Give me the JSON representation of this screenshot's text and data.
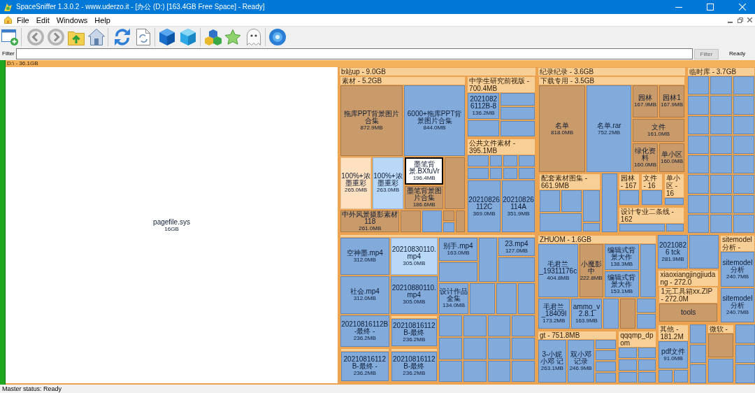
{
  "window": {
    "title": "SpaceSniffer 1.3.0.2 - www.uderzo.it - [办公 (D:) [163.4GB Free Space] - Ready]"
  },
  "menu": [
    "File",
    "Edit",
    "Windows",
    "Help"
  ],
  "filter": {
    "label": "Filter",
    "button": {
      "label": "Filter",
      "disabled": true
    },
    "status": "Ready"
  },
  "root": {
    "label": "D:\\ - 36.1GB",
    "children": [
      {
        "kind": "plain",
        "name": "pagefile.sys",
        "size": "16GB",
        "selected": false,
        "highlighted": false
      },
      {
        "kind": "folder",
        "label": "b站up - 9.0GB",
        "selected": false,
        "highlighted": false,
        "children": [
          {
            "kind": "folder",
            "label": "素材 - 5.2GB",
            "selected": false,
            "highlighted": false,
            "children": [
              {
                "kind": "dir",
                "name": "拖库PPT背景图片合集",
                "size": "872.9MB",
                "selected": false,
                "highlighted": false
              },
              {
                "kind": "file",
                "name": "6000+拖库PPT背景图片合集",
                "size": "844.0MB",
                "selected": false,
                "highlighted": false
              },
              {
                "kind": "dir",
                "name": "100%+浓墨重彩",
                "size": "265.0MB",
                "selected": false,
                "highlighted": true
              },
              {
                "kind": "file",
                "name": "100%+浓墨重彩",
                "size": "263.0MB",
                "selected": false,
                "highlighted": true
              },
              {
                "kind": "file",
                "name": "墨笔背景.BXfuVr",
                "size": "196.4MB",
                "selected": true,
                "highlighted": false
              },
              {
                "kind": "dir",
                "name": "墨笔背景图片合集",
                "size": "186.6MB",
                "selected": false,
                "highlighted": false
              },
              {
                "kind": "dir",
                "selected": false,
                "highlighted": false
              },
              {
                "kind": "dir",
                "name": "中外风景摄影素材 118",
                "size": "261.0MB",
                "selected": false,
                "highlighted": false
              },
              {
                "kind": "dir",
                "selected": false,
                "highlighted": false
              },
              {
                "kind": "file",
                "selected": false,
                "highlighted": false
              },
              {
                "kind": "dir",
                "selected": false,
                "highlighted": false
              },
              {
                "kind": "file",
                "selected": false,
                "highlighted": false
              },
              {
                "kind": "dir",
                "selected": false,
                "highlighted": false
              }
            ]
          },
          {
            "kind": "folder",
            "label": "中学生研究前视版 - 700.4MB",
            "selected": false,
            "highlighted": false,
            "children": [
              {
                "kind": "file",
                "name": "20210826112B-8",
                "size": "136.2MB",
                "selected": false,
                "highlighted": false
              },
              {
                "kind": "file",
                "selected": false,
                "highlighted": false
              },
              {
                "kind": "file",
                "selected": false,
                "highlighted": false
              },
              {
                "kind": "file",
                "selected": false,
                "highlighted": false
              },
              {
                "kind": "file",
                "selected": false,
                "highlighted": false
              }
            ]
          },
          {
            "kind": "folder",
            "label": "公共文件素材 - 395.1MB",
            "selected": false,
            "highlighted": false,
            "children": [
              {
                "kind": "file",
                "selected": false,
                "highlighted": false
              },
              {
                "kind": "file",
                "selected": false,
                "highlighted": false
              },
              {
                "kind": "file",
                "selected": false,
                "highlighted": false
              },
              {
                "kind": "file",
                "selected": false,
                "highlighted": false
              },
              {
                "kind": "file",
                "selected": false,
                "highlighted": false
              },
              {
                "kind": "file",
                "selected": false,
                "highlighted": false
              },
              {
                "kind": "file",
                "selected": false,
                "highlighted": false
              },
              {
                "kind": "file",
                "selected": false,
                "highlighted": false
              },
              {
                "kind": "file",
                "name": "20210826112C",
                "size": "369.0MB",
                "selected": false,
                "highlighted": false
              },
              {
                "kind": "file",
                "name": "20210826114A",
                "size": "351.9MB",
                "selected": false,
                "highlighted": false
              }
            ]
          },
          {
            "kind": "folder",
            "selected": false,
            "highlighted": false,
            "children": [
              {
                "kind": "file",
                "name": "空神墨.mp4",
                "size": "312.0MB",
                "selected": false,
                "highlighted": false
              },
              {
                "kind": "file",
                "name": "社会.mp4",
                "size": "312.0MB",
                "selected": false,
                "highlighted": false
              },
              {
                "kind": "file",
                "name": "20210830110.mp4",
                "size": "305.0MB",
                "selected": false,
                "highlighted": true
              },
              {
                "kind": "file",
                "name": "20210880110.mp4",
                "size": "305.0MB",
                "selected": false,
                "highlighted": false
              },
              {
                "kind": "file",
                "name": "别手.mp4",
                "size": "163.0MB",
                "selected": false,
                "highlighted": false
              },
              {
                "kind": "file",
                "selected": false,
                "highlighted": false
              },
              {
                "kind": "file",
                "selected": false,
                "highlighted": false
              },
              {
                "kind": "file",
                "name": "23.mp4",
                "size": "127.0MB",
                "selected": false,
                "highlighted": false
              },
              {
                "kind": "file",
                "selected": false,
                "highlighted": false
              },
              {
                "kind": "file",
                "name": "设计作品全集",
                "size": "134.0MB",
                "selected": false,
                "highlighted": false
              },
              {
                "kind": "file",
                "selected": false,
                "highlighted": false
              },
              {
                "kind": "file",
                "selected": false,
                "highlighted": false
              },
              {
                "kind": "file",
                "selected": false,
                "highlighted": false
              },
              {
                "kind": "file",
                "name": "20210816112B-最终 -",
                "size": "236.2MB",
                "selected": false,
                "highlighted": false
              },
              {
                "kind": "folder",
                "selected": false,
                "highlighted": false,
                "children": [
                  {
                    "kind": "file",
                    "name": "20210816112B-最终 -",
                    "size": "236.2MB",
                    "selected": false,
                    "highlighted": false
                  }
                ]
              },
              {
                "kind": "folder",
                "selected": false,
                "highlighted": false,
                "children": [
                  {
                    "kind": "file",
                    "name": "20210816112B-最终",
                    "size": "236.2MB",
                    "selected": false,
                    "highlighted": false
                  }
                ]
              },
              {
                "kind": "folder",
                "selected": false,
                "highlighted": false,
                "children": [
                  {
                    "kind": "file",
                    "name": "20210816112B-最终",
                    "size": "236.2MB",
                    "selected": false,
                    "highlighted": false
                  }
                ]
              },
              {
                "kind": "file",
                "selected": false,
                "highlighted": false
              },
              {
                "kind": "file",
                "selected": false,
                "highlighted": false
              },
              {
                "kind": "file",
                "selected": false,
                "highlighted": false
              },
              {
                "kind": "file",
                "selected": false,
                "highlighted": false
              },
              {
                "kind": "file",
                "selected": false,
                "highlighted": false
              },
              {
                "kind": "file",
                "selected": false,
                "highlighted": false
              },
              {
                "kind": "file",
                "selected": false,
                "highlighted": false
              },
              {
                "kind": "file",
                "selected": false,
                "highlighted": false
              },
              {
                "kind": "file",
                "selected": false,
                "highlighted": false
              },
              {
                "kind": "file",
                "selected": false,
                "highlighted": false
              },
              {
                "kind": "file",
                "selected": false,
                "highlighted": false
              },
              {
                "kind": "file",
                "selected": false,
                "highlighted": false
              }
            ]
          }
        ]
      },
      {
        "kind": "folder",
        "label": "纪录纪录 - 3.6GB",
        "selected": false,
        "highlighted": false,
        "children": [
          {
            "kind": "folder",
            "label": "下载专用 - 3.5GB",
            "selected": false,
            "highlighted": false,
            "children": [
              {
                "kind": "dir",
                "name": "名单",
                "size": "818.0MB",
                "selected": false,
                "highlighted": false
              },
              {
                "kind": "file",
                "name": "名单.rar",
                "size": "752.2MB",
                "selected": false,
                "highlighted": false
              },
              {
                "kind": "dir",
                "name": "园林",
                "size": "167.9MB",
                "selected": false,
                "highlighted": false
              },
              {
                "kind": "dir",
                "name": "园林1",
                "size": "167.9MB",
                "selected": false,
                "highlighted": false
              },
              {
                "kind": "dir",
                "name": "文件",
                "size": "161.0MB",
                "selected": false,
                "highlighted": false
              },
              {
                "kind": "dir",
                "name": "绿化资料",
                "size": "160.0MB",
                "selected": false,
                "highlighted": false
              },
              {
                "kind": "dir",
                "name": "单小区",
                "size": "160.0MB",
                "selected": false,
                "highlighted": false
              },
              {
                "kind": "folder",
                "label": "配套素材图集 - 661.9MB",
                "selected": false,
                "highlighted": false,
                "children": [
                  {
                    "kind": "file",
                    "selected": false,
                    "highlighted": false
                  },
                  {
                    "kind": "file",
                    "selected": false,
                    "highlighted": false
                  },
                  {
                    "kind": "file",
                    "selected": false,
                    "highlighted": false
                  },
                  {
                    "kind": "file",
                    "selected": false,
                    "highlighted": false
                  },
                  {
                    "kind": "file",
                    "selected": false,
                    "highlighted": false
                  }
                ]
              },
              {
                "kind": "file",
                "selected": false,
                "highlighted": false
              },
              {
                "kind": "folder",
                "label": "园林 - 167",
                "selected": false,
                "highlighted": false,
                "children": [
                  {
                    "kind": "file",
                    "selected": false,
                    "highlighted": false
                  }
                ]
              },
              {
                "kind": "folder",
                "label": "文件 - 16",
                "selected": false,
                "highlighted": false,
                "children": [
                  {
                    "kind": "file",
                    "selected": false,
                    "highlighted": false
                  }
                ]
              },
              {
                "kind": "folder",
                "label": "单小区 - 16",
                "selected": false,
                "highlighted": false,
                "children": [
                  {
                    "kind": "file",
                    "selected": false,
                    "highlighted": false
                  }
                ]
              },
              {
                "kind": "folder",
                "label": "设计专业二条线 - 162",
                "selected": false,
                "highlighted": false,
                "children": [
                  {
                    "kind": "file",
                    "selected": false,
                    "highlighted": false
                  },
                  {
                    "kind": "file",
                    "selected": false,
                    "highlighted": false
                  }
                ]
              }
            ]
          }
        ]
      },
      {
        "kind": "folder",
        "label": "临时库 - 3.7GB",
        "selected": false,
        "highlighted": false,
        "children": [
          {
            "kind": "file",
            "selected": false,
            "highlighted": false
          },
          {
            "kind": "file",
            "selected": false,
            "highlighted": false
          },
          {
            "kind": "file",
            "selected": false,
            "highlighted": false
          },
          {
            "kind": "file",
            "selected": false,
            "highlighted": false
          },
          {
            "kind": "file",
            "selected": false,
            "highlighted": false
          },
          {
            "kind": "file",
            "selected": false,
            "highlighted": false
          },
          {
            "kind": "file",
            "selected": false,
            "highlighted": false
          },
          {
            "kind": "file",
            "selected": false,
            "highlighted": false
          },
          {
            "kind": "file",
            "selected": false,
            "highlighted": false
          },
          {
            "kind": "file",
            "selected": false,
            "highlighted": false
          },
          {
            "kind": "file",
            "selected": false,
            "highlighted": false
          },
          {
            "kind": "file",
            "selected": false,
            "highlighted": false
          },
          {
            "kind": "file",
            "selected": false,
            "highlighted": false
          },
          {
            "kind": "file",
            "selected": false,
            "highlighted": false
          },
          {
            "kind": "file",
            "selected": false,
            "highlighted": false
          },
          {
            "kind": "file",
            "selected": false,
            "highlighted": false
          },
          {
            "kind": "file",
            "selected": false,
            "highlighted": false
          },
          {
            "kind": "file",
            "selected": false,
            "highlighted": false
          },
          {
            "kind": "file",
            "selected": false,
            "highlighted": false
          },
          {
            "kind": "file",
            "selected": false,
            "highlighted": false
          },
          {
            "kind": "file",
            "selected": false,
            "highlighted": false
          },
          {
            "kind": "file",
            "selected": false,
            "highlighted": false
          },
          {
            "kind": "file",
            "selected": false,
            "highlighted": false
          },
          {
            "kind": "file",
            "selected": false,
            "highlighted": false
          }
        ]
      },
      {
        "kind": "folder",
        "label": "ZHUOM - 1.6GB",
        "selected": false,
        "highlighted": false,
        "children": [
          {
            "kind": "file",
            "name": "毛君兰_19311176c",
            "size": "404.8MB",
            "selected": false,
            "highlighted": false
          },
          {
            "kind": "dir",
            "name": "小魔影中",
            "size": "222.8MB",
            "selected": false,
            "highlighted": false
          },
          {
            "kind": "file",
            "name": "编辑式背景大作",
            "size": "138.3MB",
            "selected": false,
            "highlighted": false
          },
          {
            "kind": "file",
            "name": "编辑式背景大作",
            "size": "153.1MB",
            "selected": false,
            "highlighted": false
          },
          {
            "kind": "file",
            "selected": false,
            "highlighted": false
          },
          {
            "kind": "file",
            "name": "毛君兰_18409l",
            "size": "173.2MB",
            "selected": false,
            "highlighted": false
          },
          {
            "kind": "file",
            "name": "ammo_v2.8.1",
            "size": "163.9MB",
            "selected": false,
            "highlighted": false
          },
          {
            "kind": "file",
            "selected": false,
            "highlighted": false
          },
          {
            "kind": "dir",
            "selected": false,
            "highlighted": false
          },
          {
            "kind": "file",
            "selected": false,
            "highlighted": false
          },
          {
            "kind": "file",
            "selected": false,
            "highlighted": false
          }
        ]
      },
      {
        "kind": "folder",
        "label": "gt - 751.8MB",
        "selected": false,
        "highlighted": false,
        "children": [
          {
            "kind": "file",
            "name": "3-小妮小邓 记",
            "size": "263.1MB",
            "selected": false,
            "highlighted": false
          },
          {
            "kind": "file",
            "name": "双小邓记录",
            "size": "246.9MB",
            "selected": false,
            "highlighted": false
          },
          {
            "kind": "file",
            "selected": false,
            "highlighted": false
          },
          {
            "kind": "file",
            "selected": false,
            "highlighted": false
          },
          {
            "kind": "file",
            "selected": false,
            "highlighted": false
          },
          {
            "kind": "file",
            "selected": false,
            "highlighted": false
          }
        ]
      },
      {
        "kind": "folder",
        "label": "qqqmp_dpom",
        "selected": false,
        "highlighted": false,
        "children": [
          {
            "kind": "file",
            "selected": false,
            "highlighted": false
          },
          {
            "kind": "file",
            "selected": false,
            "highlighted": false
          },
          {
            "kind": "file",
            "selected": false,
            "highlighted": false
          },
          {
            "kind": "file",
            "selected": false,
            "highlighted": false
          },
          {
            "kind": "file",
            "selected": false,
            "highlighted": false
          },
          {
            "kind": "file",
            "selected": false,
            "highlighted": false
          }
        ]
      },
      {
        "kind": "file",
        "name": "20210826 tck",
        "size": "281.9MB",
        "selected": false,
        "highlighted": false
      },
      {
        "kind": "file",
        "selected": false,
        "highlighted": false
      },
      {
        "kind": "folder",
        "label": "xiaoxiangjingjiudang - 272.0",
        "selected": false,
        "highlighted": false,
        "children": [
          {
            "kind": "folder",
            "label": "1元工具箱xx.ZIP - 272.0M",
            "selected": false,
            "highlighted": false,
            "children": [
              {
                "kind": "dir",
                "name": "tools",
                "selected": false,
                "highlighted": false
              }
            ]
          }
        ]
      },
      {
        "kind": "folder",
        "label": "sitemodel分析 -",
        "selected": false,
        "highlighted": false,
        "children": [
          {
            "kind": "file",
            "name": "sitemodel分析",
            "size": "240.7MB",
            "selected": false,
            "highlighted": false
          },
          {
            "kind": "file",
            "name": "sitemodel分析",
            "size": "240.7MB",
            "selected": false,
            "highlighted": false
          }
        ]
      },
      {
        "kind": "folder",
        "label": "其他 - 181.2M",
        "selected": false,
        "highlighted": false,
        "children": [
          {
            "kind": "file",
            "name": "pdf文件",
            "size": "91.0MB",
            "selected": false,
            "highlighted": false
          },
          {
            "kind": "file",
            "selected": false,
            "highlighted": false
          },
          {
            "kind": "file",
            "selected": false,
            "highlighted": false
          }
        ]
      },
      {
        "kind": "file",
        "selected": false,
        "highlighted": false
      },
      {
        "kind": "file",
        "selected": false,
        "highlighted": false
      },
      {
        "kind": "file",
        "selected": false,
        "highlighted": false
      },
      {
        "kind": "folder",
        "label": "微软 -",
        "selected": false,
        "highlighted": false,
        "children": [
          {
            "kind": "dir",
            "selected": false,
            "highlighted": false
          },
          {
            "kind": "file",
            "selected": false,
            "highlighted": false
          }
        ]
      },
      {
        "kind": "file",
        "selected": false,
        "highlighted": false
      },
      {
        "kind": "file",
        "selected": false,
        "highlighted": false
      },
      {
        "kind": "file",
        "selected": false,
        "highlighted": false
      }
    ]
  },
  "status_bar": "Master status: Ready"
}
